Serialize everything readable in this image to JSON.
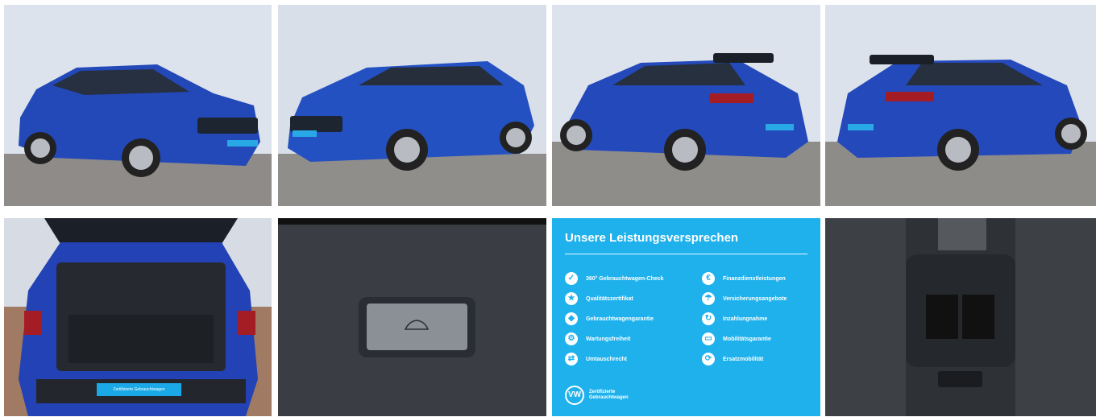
{
  "gallery": {
    "tiles": [
      {
        "name": "photo-front-left-three-quarter"
      },
      {
        "name": "photo-front-right-three-quarter"
      },
      {
        "name": "photo-rear-left-three-quarter"
      },
      {
        "name": "photo-rear-right-three-quarter"
      },
      {
        "name": "photo-open-trunk"
      },
      {
        "name": "photo-tailgate-button-closeup"
      },
      {
        "name": "promise-infographic"
      },
      {
        "name": "photo-rear-air-vents"
      }
    ]
  },
  "promise": {
    "title": "Unsere Leistungsversprechen",
    "left_items": [
      {
        "label": "360° Gebrauchtwagen-Check",
        "icon": "check-icon"
      },
      {
        "label": "Qualitätszertifikat",
        "icon": "certificate-icon"
      },
      {
        "label": "Gebrauchtwagengarantie",
        "icon": "shield-icon"
      },
      {
        "label": "Wartungsfreiheit",
        "icon": "wrench-icon"
      },
      {
        "label": "Umtauschrecht",
        "icon": "exchange-icon"
      }
    ],
    "right_items": [
      {
        "label": "Finanzdienstleistungen",
        "icon": "finance-icon"
      },
      {
        "label": "Versicherungsangebote",
        "icon": "insurance-icon"
      },
      {
        "label": "Inzahlungnahme",
        "icon": "tradein-icon"
      },
      {
        "label": "Mobilitätsgarantie",
        "icon": "car-icon"
      },
      {
        "label": "Ersatzmobilität",
        "icon": "replacement-icon"
      }
    ],
    "badge_line1": "Zertifizierte",
    "badge_line2": "Gebrauchtwagen",
    "badge_logo": "VW"
  },
  "trunk_plate": "Zertifizierte Gebrauchtwagen",
  "colors": {
    "car_blue": "#2348b8",
    "promise_bg": "#1fb1ec",
    "sky": "#dfe5ee",
    "pavement": "#8f8d8a"
  }
}
